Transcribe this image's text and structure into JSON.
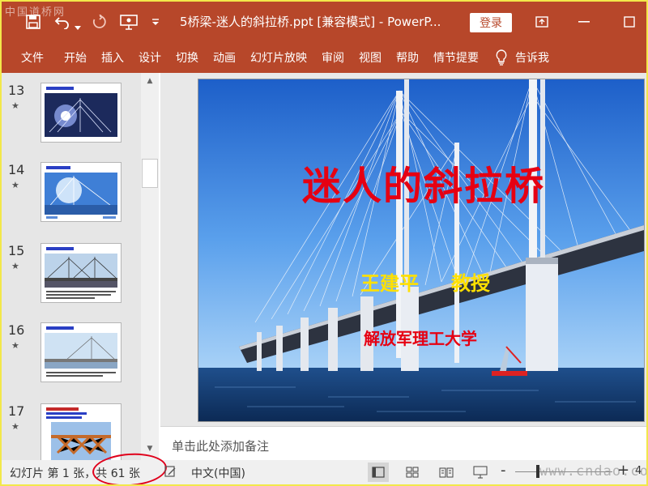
{
  "watermark_top": "中国道桥网",
  "watermark_bottom": "www.cndao.com",
  "titlebar": {
    "title": "5桥梁-迷人的斜拉桥.ppt [兼容模式] - PowerP...",
    "login": "登录"
  },
  "ribbon": {
    "tabs": [
      "文件",
      "开始",
      "插入",
      "设计",
      "切换",
      "动画",
      "幻灯片放映",
      "审阅",
      "视图",
      "帮助",
      "情节提要"
    ],
    "tell_me": "告诉我"
  },
  "thumbnails": [
    {
      "num": "13",
      "star": "★"
    },
    {
      "num": "14",
      "star": "★"
    },
    {
      "num": "15",
      "star": "★"
    },
    {
      "num": "16",
      "star": "★"
    },
    {
      "num": "17",
      "star": "★"
    }
  ],
  "slide": {
    "title": "迷人的斜拉桥",
    "author_name": "王建平",
    "author_title": "教授",
    "school": "解放军理工大学"
  },
  "notes": {
    "placeholder": "单击此处添加备注"
  },
  "status": {
    "slide_info": "幻灯片 第 1 张，共 61 张",
    "language": "中文(中国)",
    "zoom_minus": "-",
    "zoom_plus": "+",
    "zoom_pct": "4"
  },
  "colors": {
    "ribbon": "#b7472a",
    "slide_title": "#e60012",
    "slide_author": "#ffe000"
  }
}
